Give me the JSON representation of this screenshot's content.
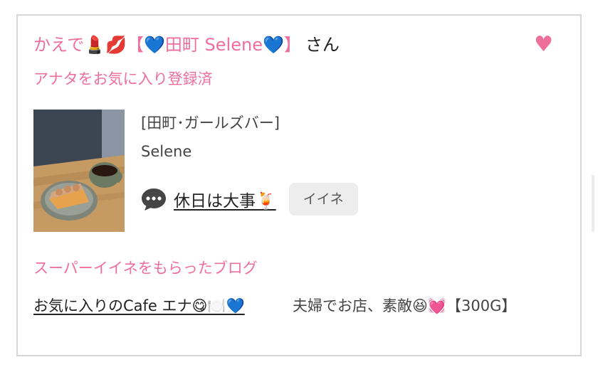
{
  "notice": {
    "sender_name": "かえで💄💋【💙田町 Selene💙】",
    "sender_suffix": "さん",
    "favorite_status": "アナタをお気に入り登録済",
    "heart_icon": "♥"
  },
  "shop": {
    "category": "[田町･ガールズバー]",
    "name": "Selene"
  },
  "blog": {
    "icon": "speech-bubble-icon",
    "title": "休日は大事🍹",
    "iine_label": "イイネ"
  },
  "super_iine": {
    "heading": "スーパーイイネをもらったブログ",
    "items": [
      {
        "title": "お気に入りのCafe エナ😋🍽️💙"
      },
      {
        "title": "夫婦でお店、素敵😆💓【300G】"
      }
    ]
  },
  "colors": {
    "accent": "#ee6f9a",
    "iine_bg": "#ededed",
    "border": "#d6d6d6"
  }
}
